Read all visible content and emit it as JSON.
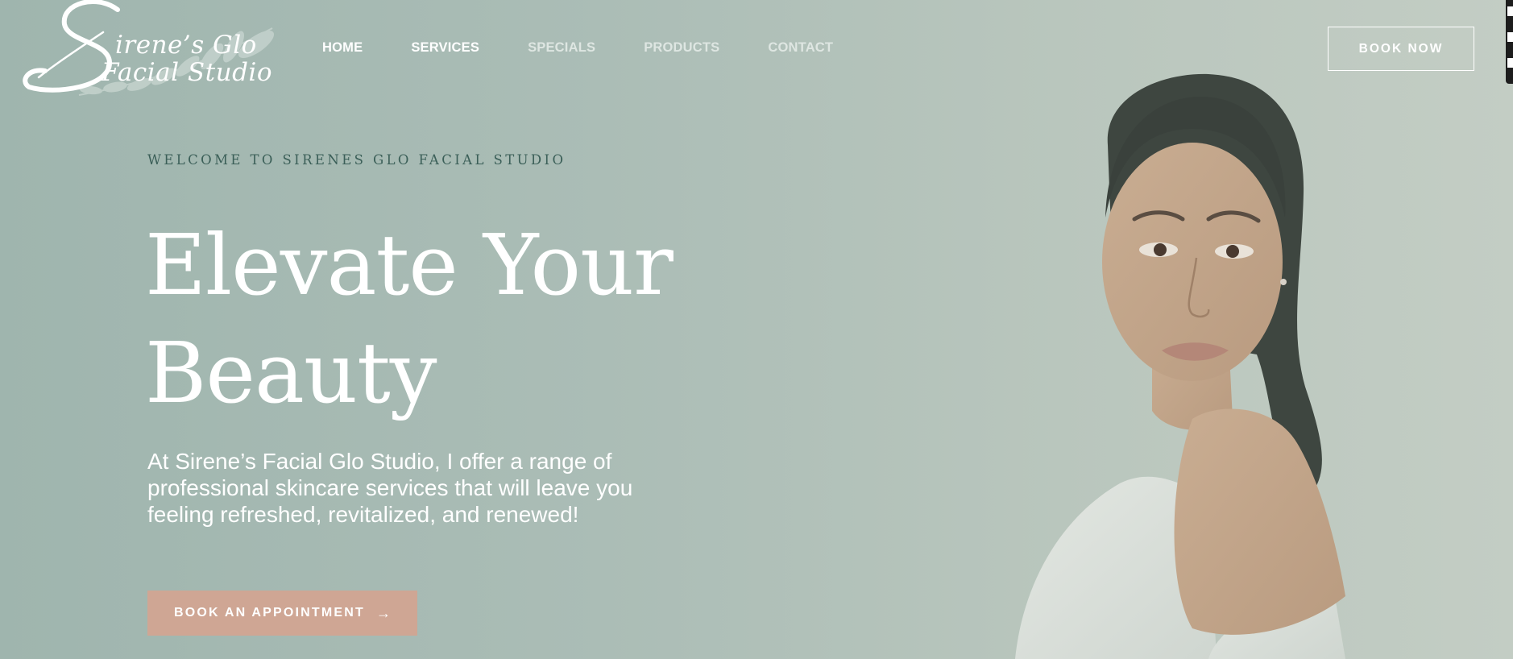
{
  "logo": {
    "initial": "S",
    "line1": "irene’s Glo",
    "line2": "Facial Studio"
  },
  "nav": {
    "items": [
      {
        "label": "HOME",
        "active": true
      },
      {
        "label": "SERVICES",
        "active": true
      },
      {
        "label": "SPECIALS",
        "active": false
      },
      {
        "label": "PRODUCTS",
        "active": false
      },
      {
        "label": "CONTACT",
        "active": false
      }
    ],
    "book_now_label": "BOOK NOW"
  },
  "hero": {
    "eyebrow": "WELCOME TO SIRENES GLO FACIAL STUDIO",
    "headline_line1": "Elevate Your",
    "headline_line2": "Beauty",
    "lede": "At Sirene’s Facial Glo Studio, I offer a range of professional skincare services that will leave you feeling refreshed, revitalized, and renewed!",
    "cta_label": "BOOK AN APPOINTMENT",
    "cta_icon": "arrow-right-icon"
  },
  "colors": {
    "background": "#abbdb6",
    "accent_button": "#cfa694",
    "eyebrow_text": "#3b5f58",
    "text": "#ffffff"
  }
}
